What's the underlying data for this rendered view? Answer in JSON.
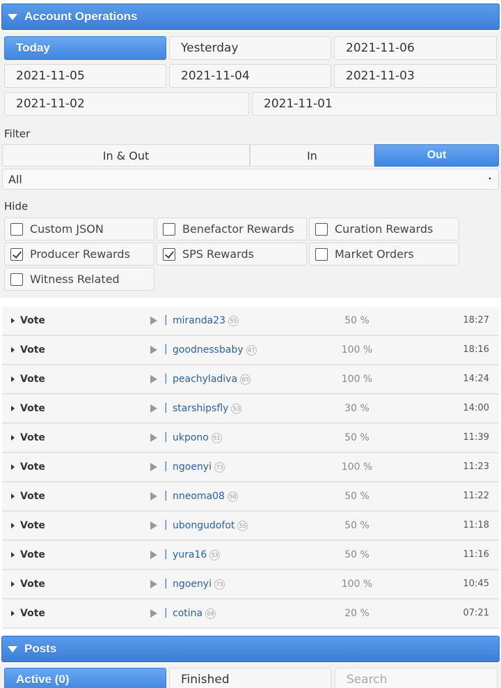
{
  "account_operations": {
    "title": "Account Operations",
    "date_tabs": [
      "Today",
      "Yesterday",
      "2021-11-06",
      "2021-11-05",
      "2021-11-04",
      "2021-11-03",
      "2021-11-02",
      "2021-11-01"
    ],
    "active_date_tab": "Today",
    "filter": {
      "label": "Filter",
      "segments": [
        "In & Out",
        "In",
        "Out"
      ],
      "active_segment": "Out",
      "type_select": "All"
    },
    "hide": {
      "label": "Hide",
      "options": [
        {
          "label": "Custom JSON",
          "checked": false
        },
        {
          "label": "Benefactor Rewards",
          "checked": false
        },
        {
          "label": "Curation Rewards",
          "checked": false
        },
        {
          "label": "Producer Rewards",
          "checked": true
        },
        {
          "label": "SPS Rewards",
          "checked": true
        },
        {
          "label": "Market Orders",
          "checked": false
        },
        {
          "label": "Witness Related",
          "checked": false
        }
      ]
    },
    "operations": [
      {
        "type": "Vote",
        "user": "miranda23",
        "rep": "55",
        "weight": "50 %",
        "time": "18:27"
      },
      {
        "type": "Vote",
        "user": "goodnessbaby",
        "rep": "47",
        "weight": "100 %",
        "time": "18:16"
      },
      {
        "type": "Vote",
        "user": "peachyladiva",
        "rep": "65",
        "weight": "100 %",
        "time": "14:24"
      },
      {
        "type": "Vote",
        "user": "starshipsfly",
        "rep": "53",
        "weight": "30 %",
        "time": "14:00"
      },
      {
        "type": "Vote",
        "user": "ukpono",
        "rep": "51",
        "weight": "50 %",
        "time": "11:39"
      },
      {
        "type": "Vote",
        "user": "ngoenyi",
        "rep": "73",
        "weight": "100 %",
        "time": "11:23"
      },
      {
        "type": "Vote",
        "user": "nneoma08",
        "rep": "58",
        "weight": "50 %",
        "time": "11:22"
      },
      {
        "type": "Vote",
        "user": "ubongudofot",
        "rep": "55",
        "weight": "50 %",
        "time": "11:18"
      },
      {
        "type": "Vote",
        "user": "yura16",
        "rep": "53",
        "weight": "50 %",
        "time": "11:16"
      },
      {
        "type": "Vote",
        "user": "ngoenyi",
        "rep": "73",
        "weight": "100 %",
        "time": "10:45"
      },
      {
        "type": "Vote",
        "user": "cotina",
        "rep": "69",
        "weight": "20 %",
        "time": "07:21"
      }
    ]
  },
  "posts": {
    "title": "Posts",
    "tabs": [
      "Active (0)",
      "Finished"
    ],
    "active_tab": "Active (0)",
    "search_placeholder": "Search"
  },
  "colors": {
    "accent": "#3e86e0",
    "link": "#2a5fa0"
  }
}
